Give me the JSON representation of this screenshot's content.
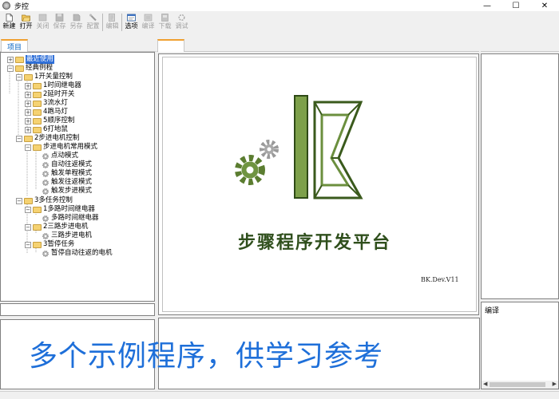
{
  "window": {
    "title": "步控",
    "minimize_glyph": "—",
    "maximize_glyph": "☐",
    "close_glyph": "✕"
  },
  "toolbar": {
    "buttons": [
      {
        "label": "新建",
        "icon": "new-file-icon",
        "enabled": true
      },
      {
        "label": "打开",
        "icon": "open-folder-icon",
        "enabled": true
      },
      {
        "label": "关闭",
        "icon": "close-file-icon",
        "enabled": false
      },
      {
        "label": "保存",
        "icon": "save-icon",
        "enabled": false
      },
      {
        "label": "另存",
        "icon": "save-as-icon",
        "enabled": false
      },
      {
        "label": "配置",
        "icon": "config-wrench-icon",
        "enabled": false
      },
      {
        "label": "编辑",
        "icon": "edit-icon",
        "enabled": false
      },
      {
        "label": "选项",
        "icon": "options-icon",
        "enabled": true
      },
      {
        "label": "编译",
        "icon": "compile-icon",
        "enabled": false
      },
      {
        "label": "下载",
        "icon": "download-icon",
        "enabled": false
      },
      {
        "label": "调试",
        "icon": "debug-icon",
        "enabled": false
      }
    ]
  },
  "left_panel": {
    "tab_label": "项目"
  },
  "tree": {
    "items": [
      {
        "label": "最近使用",
        "type": "folder",
        "selected": true
      },
      {
        "label": "经典例程",
        "type": "folder"
      },
      {
        "label": "1开关量控制",
        "type": "folder"
      },
      {
        "label": "1时间继电器",
        "type": "folder"
      },
      {
        "label": "2延时开关",
        "type": "folder"
      },
      {
        "label": "3流水灯",
        "type": "folder"
      },
      {
        "label": "4跑马灯",
        "type": "folder"
      },
      {
        "label": "5顺序控制",
        "type": "folder"
      },
      {
        "label": "6打地鼠",
        "type": "folder"
      },
      {
        "label": "2步进电机控制",
        "type": "folder"
      },
      {
        "label": "步进电机常用模式",
        "type": "folder"
      },
      {
        "label": "点动模式",
        "type": "file"
      },
      {
        "label": "自动往返模式",
        "type": "file"
      },
      {
        "label": "触发单程模式",
        "type": "file"
      },
      {
        "label": "触发往返模式",
        "type": "file"
      },
      {
        "label": "触发步进模式",
        "type": "file"
      },
      {
        "label": "3多任务控制",
        "type": "folder"
      },
      {
        "label": "1多路时间继电器",
        "type": "folder"
      },
      {
        "label": "多路时间继电器",
        "type": "file"
      },
      {
        "label": "2三路步进电机",
        "type": "folder"
      },
      {
        "label": "三路步进电机",
        "type": "file"
      },
      {
        "label": "3暂停任务",
        "type": "folder"
      },
      {
        "label": "暂停自动往返的电机",
        "type": "file"
      }
    ]
  },
  "center": {
    "brand_title": "步骤程序开发平台",
    "version": "BK.Dev.V11",
    "banner": "多个示例程序，供学习参考"
  },
  "right_panel": {
    "compile_label": "编译"
  },
  "colors": {
    "logo_green": "#6b8f3e",
    "banner_blue": "#1e6fd9",
    "selection_blue": "#3070d8",
    "tab_accent": "#f0a030"
  }
}
